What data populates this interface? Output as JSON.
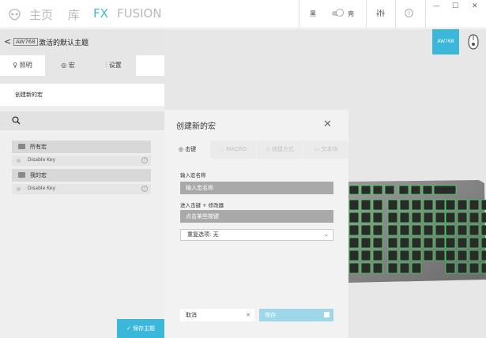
{
  "topbar": {
    "nav": [
      "主页",
      "库",
      "FX",
      "FUSION"
    ],
    "theme_dark": "黑",
    "theme_light": "亮"
  },
  "subbar": {
    "back": "<",
    "device": "AW768",
    "title": "激活的默认主题"
  },
  "tabs": [
    {
      "icon": "lightbulb-icon",
      "label": "照明"
    },
    {
      "icon": "macro-icon",
      "label": "宏"
    },
    {
      "icon": "settings-icon",
      "label": "设置"
    }
  ],
  "left": {
    "create_macro": "创建新的宏",
    "groups": [
      {
        "label": "所有宏",
        "items": [
          "Disable Key"
        ]
      },
      {
        "label": "我的宏",
        "items": [
          "Disable Key"
        ]
      }
    ],
    "save_theme": "✓ 保存主题"
  },
  "right": {
    "device_tile": "AW768"
  },
  "dialog": {
    "title": "创建新的宏",
    "tabs": [
      "击键",
      "MACRO",
      "快捷方式",
      "文本块"
    ],
    "name_label": "输入宏名称",
    "name_placeholder": "输入宏名称",
    "keystroke_label": "进入击键 + 修改器",
    "keystroke_placeholder": "点击某些按键",
    "repeat_select": "重复选项: 无",
    "cancel": "取消",
    "save": "保存"
  },
  "colors": {
    "accent": "#3bb7da",
    "keyboard_glow": "#3ddc5a"
  }
}
